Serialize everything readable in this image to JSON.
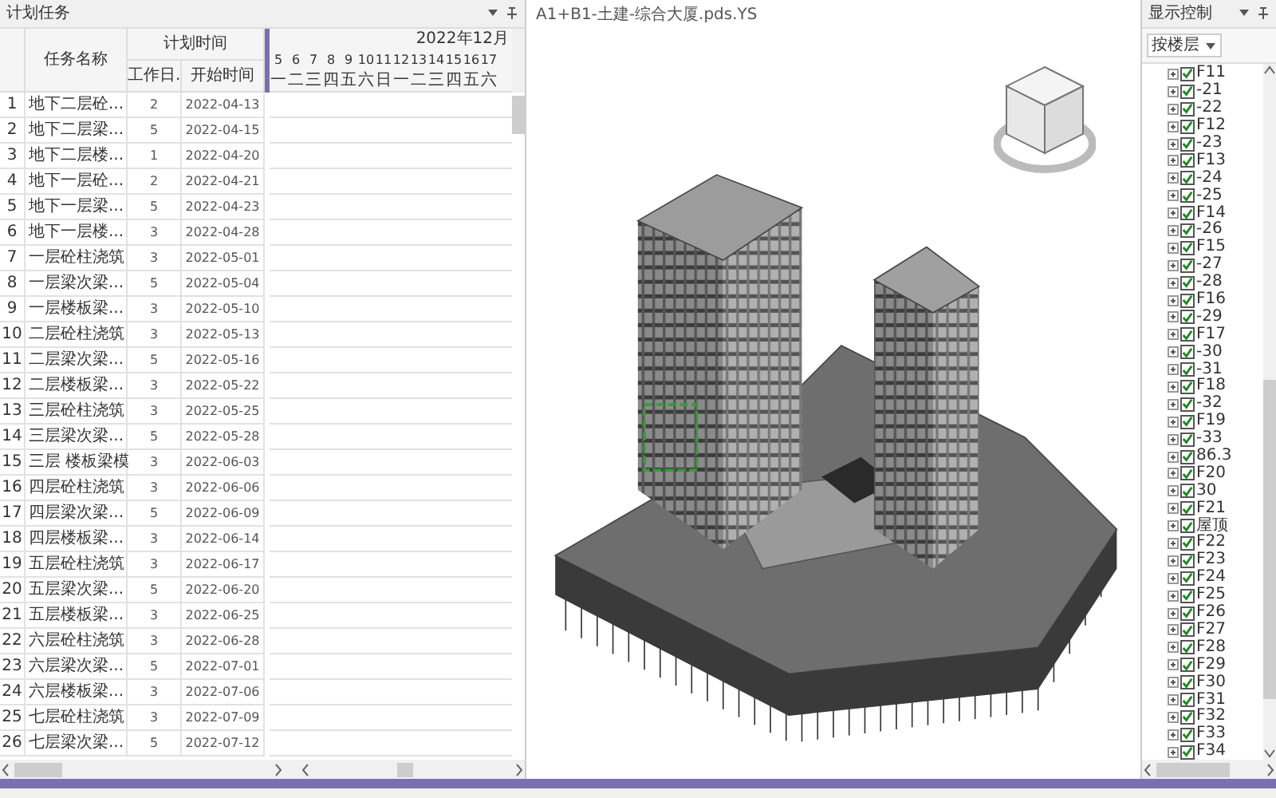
{
  "left_panel": {
    "title": "计划任务",
    "columns": {
      "name": "任务名称",
      "group": "计划时间",
      "work_days": "工作日.",
      "start": "开始时间"
    },
    "gantt": {
      "month": "2022年12月",
      "days": [
        {
          "day": "5",
          "weekday": "一"
        },
        {
          "day": "6",
          "weekday": "二"
        },
        {
          "day": "7",
          "weekday": "三"
        },
        {
          "day": "8",
          "weekday": "四"
        },
        {
          "day": "9",
          "weekday": "五"
        },
        {
          "day": "10",
          "weekday": "六"
        },
        {
          "day": "11",
          "weekday": "日"
        },
        {
          "day": "12",
          "weekday": "一"
        },
        {
          "day": "13",
          "weekday": "二"
        },
        {
          "day": "14",
          "weekday": "三"
        },
        {
          "day": "15",
          "weekday": "四"
        },
        {
          "day": "16",
          "weekday": "五"
        },
        {
          "day": "17",
          "weekday": "六"
        }
      ]
    },
    "rows": [
      {
        "no": "1",
        "name": "地下二层砼...",
        "work_days": "2",
        "start": "2022-04-13"
      },
      {
        "no": "2",
        "name": "地下二层梁...",
        "work_days": "5",
        "start": "2022-04-15"
      },
      {
        "no": "3",
        "name": "地下二层楼...",
        "work_days": "1",
        "start": "2022-04-20"
      },
      {
        "no": "4",
        "name": "地下一层砼...",
        "work_days": "2",
        "start": "2022-04-21"
      },
      {
        "no": "5",
        "name": "地下一层梁...",
        "work_days": "5",
        "start": "2022-04-23"
      },
      {
        "no": "6",
        "name": "地下一层楼...",
        "work_days": "3",
        "start": "2022-04-28"
      },
      {
        "no": "7",
        "name": "一层砼柱浇筑",
        "work_days": "3",
        "start": "2022-05-01"
      },
      {
        "no": "8",
        "name": "一层梁次梁...",
        "work_days": "5",
        "start": "2022-05-04"
      },
      {
        "no": "9",
        "name": "一层楼板梁...",
        "work_days": "3",
        "start": "2022-05-10"
      },
      {
        "no": "10",
        "name": "二层砼柱浇筑",
        "work_days": "3",
        "start": "2022-05-13"
      },
      {
        "no": "11",
        "name": "二层梁次梁...",
        "work_days": "5",
        "start": "2022-05-16"
      },
      {
        "no": "12",
        "name": "二层楼板梁...",
        "work_days": "3",
        "start": "2022-05-22"
      },
      {
        "no": "13",
        "name": "三层砼柱浇筑",
        "work_days": "3",
        "start": "2022-05-25"
      },
      {
        "no": "14",
        "name": "三层梁次梁...",
        "work_days": "5",
        "start": "2022-05-28"
      },
      {
        "no": "15",
        "name": "三层 楼板梁模",
        "work_days": "3",
        "start": "2022-06-03"
      },
      {
        "no": "16",
        "name": "四层砼柱浇筑",
        "work_days": "3",
        "start": "2022-06-06"
      },
      {
        "no": "17",
        "name": "四层梁次梁...",
        "work_days": "5",
        "start": "2022-06-09"
      },
      {
        "no": "18",
        "name": "四层楼板梁...",
        "work_days": "3",
        "start": "2022-06-14"
      },
      {
        "no": "19",
        "name": "五层砼柱浇筑",
        "work_days": "3",
        "start": "2022-06-17"
      },
      {
        "no": "20",
        "name": "五层梁次梁...",
        "work_days": "5",
        "start": "2022-06-20"
      },
      {
        "no": "21",
        "name": "五层楼板梁...",
        "work_days": "3",
        "start": "2022-06-25"
      },
      {
        "no": "22",
        "name": "六层砼柱浇筑",
        "work_days": "3",
        "start": "2022-06-28"
      },
      {
        "no": "23",
        "name": "六层梁次梁...",
        "work_days": "5",
        "start": "2022-07-01"
      },
      {
        "no": "24",
        "name": "六层楼板梁...",
        "work_days": "3",
        "start": "2022-07-06"
      },
      {
        "no": "25",
        "name": "七层砼柱浇筑",
        "work_days": "3",
        "start": "2022-07-09"
      },
      {
        "no": "26",
        "name": "七层梁次梁...",
        "work_days": "5",
        "start": "2022-07-12"
      }
    ]
  },
  "viewer": {
    "title": "A1+B1-土建-综合大厦.pds.YS"
  },
  "right_panel": {
    "title": "显示控制",
    "filter": "按楼层",
    "floors": [
      {
        "label": "F11",
        "checked": true,
        "expanded": false
      },
      {
        "label": "-21",
        "checked": true,
        "expanded": false
      },
      {
        "label": "-22",
        "checked": true,
        "expanded": false
      },
      {
        "label": "F12",
        "checked": true,
        "expanded": false
      },
      {
        "label": "-23",
        "checked": true,
        "expanded": false
      },
      {
        "label": "F13",
        "checked": true,
        "expanded": false
      },
      {
        "label": "-24",
        "checked": true,
        "expanded": false
      },
      {
        "label": "-25",
        "checked": true,
        "expanded": false
      },
      {
        "label": "F14",
        "checked": true,
        "expanded": false
      },
      {
        "label": "-26",
        "checked": true,
        "expanded": false
      },
      {
        "label": "F15",
        "checked": true,
        "expanded": false
      },
      {
        "label": "-27",
        "checked": true,
        "expanded": false
      },
      {
        "label": "-28",
        "checked": true,
        "expanded": false
      },
      {
        "label": "F16",
        "checked": true,
        "expanded": false
      },
      {
        "label": "-29",
        "checked": true,
        "expanded": false
      },
      {
        "label": "F17",
        "checked": true,
        "expanded": false
      },
      {
        "label": "-30",
        "checked": true,
        "expanded": false
      },
      {
        "label": "-31",
        "checked": true,
        "expanded": false
      },
      {
        "label": "F18",
        "checked": true,
        "expanded": false
      },
      {
        "label": "-32",
        "checked": true,
        "expanded": false
      },
      {
        "label": "F19",
        "checked": true,
        "expanded": false
      },
      {
        "label": "-33",
        "checked": true,
        "expanded": false
      },
      {
        "label": "86.3",
        "checked": true,
        "expanded": false
      },
      {
        "label": "F20",
        "checked": true,
        "expanded": false
      },
      {
        "label": "30",
        "checked": true,
        "expanded": false
      },
      {
        "label": "F21",
        "checked": true,
        "expanded": false
      },
      {
        "label": "屋顶",
        "checked": true,
        "expanded": false
      },
      {
        "label": "F22",
        "checked": true,
        "expanded": false
      },
      {
        "label": "F23",
        "checked": true,
        "expanded": false
      },
      {
        "label": "F24",
        "checked": true,
        "expanded": false
      },
      {
        "label": "F25",
        "checked": true,
        "expanded": false
      },
      {
        "label": "F26",
        "checked": true,
        "expanded": false
      },
      {
        "label": "F27",
        "checked": true,
        "expanded": false
      },
      {
        "label": "F28",
        "checked": true,
        "expanded": false
      },
      {
        "label": "F29",
        "checked": true,
        "expanded": false
      },
      {
        "label": "F30",
        "checked": true,
        "expanded": false
      },
      {
        "label": "F31",
        "checked": true,
        "expanded": false
      },
      {
        "label": "F32",
        "checked": true,
        "expanded": false
      },
      {
        "label": "F33",
        "checked": true,
        "expanded": false
      },
      {
        "label": "F34",
        "checked": true,
        "expanded": false
      }
    ]
  }
}
